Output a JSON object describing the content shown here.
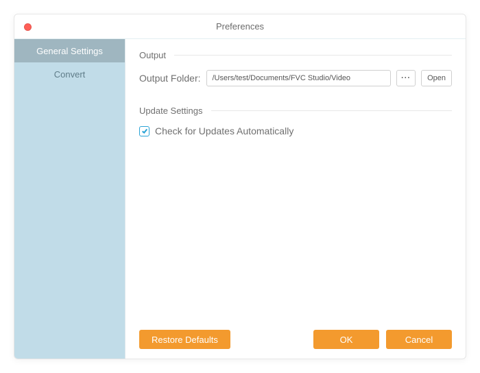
{
  "window": {
    "title": "Preferences"
  },
  "sidebar": {
    "items": [
      {
        "label": "General Settings",
        "active": true
      },
      {
        "label": "Convert",
        "active": false
      }
    ]
  },
  "sections": {
    "output": {
      "heading": "Output",
      "folder_label": "Output Folder:",
      "folder_path": "/Users/test/Documents/FVC Studio/Video",
      "browse_label": "···",
      "open_label": "Open"
    },
    "update": {
      "heading": "Update Settings",
      "checkbox_label": "Check for Updates Automatically",
      "checked": true
    }
  },
  "footer": {
    "restore_label": "Restore Defaults",
    "ok_label": "OK",
    "cancel_label": "Cancel"
  },
  "colors": {
    "accent": "#f39a2e",
    "sidebar_bg": "#c1dce8",
    "sidebar_active": "#9fb6c0",
    "checkbox": "#2aa3d6"
  }
}
